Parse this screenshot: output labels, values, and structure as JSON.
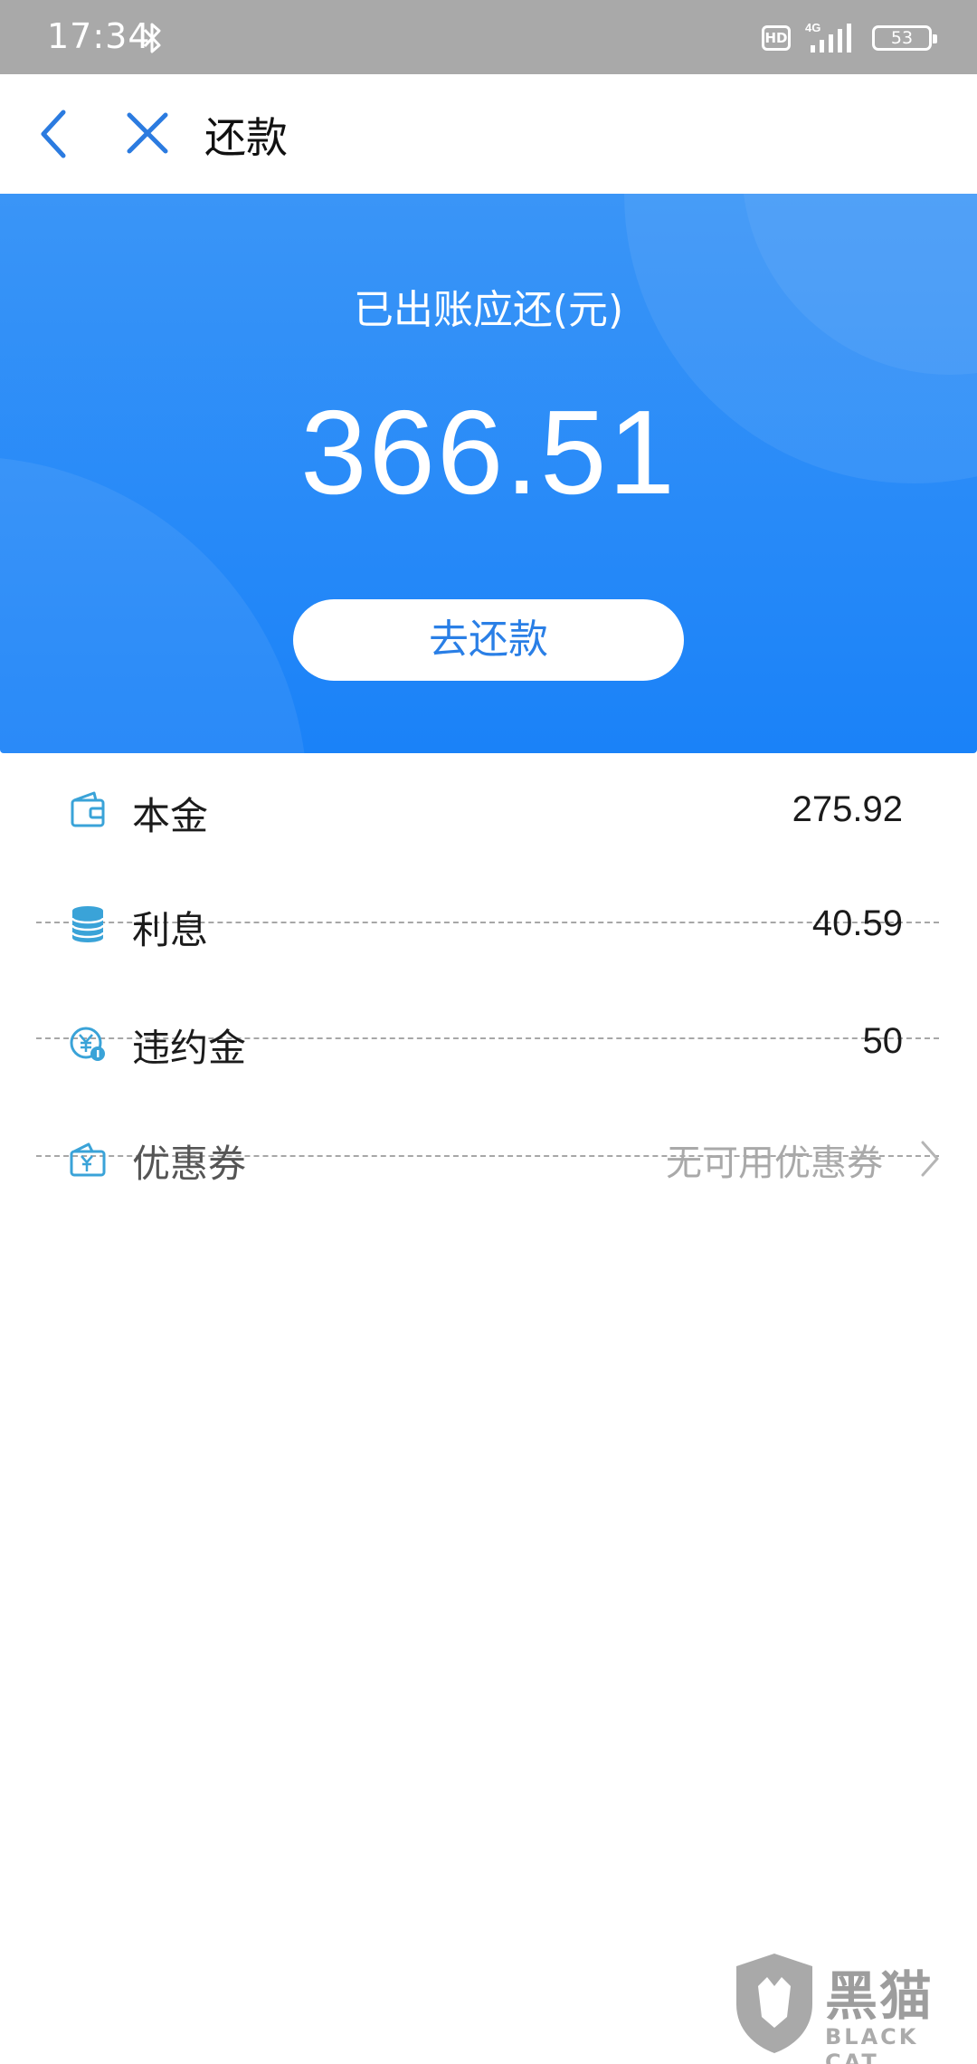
{
  "status_bar": {
    "time": "17:34",
    "bluetooth_icon": "bluetooth-icon",
    "hd_badge": "HD",
    "network": "4G",
    "battery_level": "53"
  },
  "nav": {
    "back_icon": "chevron-left-icon",
    "close_icon": "close-icon",
    "title": "还款"
  },
  "hero": {
    "label": "已出账应还(元)",
    "amount": "366.51",
    "pay_button_label": "去还款"
  },
  "details": [
    {
      "icon": "wallet-icon",
      "label": "本金",
      "value": "275.92"
    },
    {
      "icon": "coins-stack-icon",
      "label": "利息",
      "value": "40.59"
    },
    {
      "icon": "yuan-penalty-icon",
      "label": "违约金",
      "value": "50"
    }
  ],
  "coupon": {
    "icon": "coupon-wallet-icon",
    "label": "优惠券",
    "value": "无可用优惠券",
    "chevron_icon": "chevron-right-icon"
  },
  "watermark": {
    "title": "黑猫",
    "subtitle": "BLACK CAT"
  },
  "colors": {
    "accent": "#1a82f8",
    "status_bar": "#a9a9a9",
    "icon_tint": "#3aa3d8",
    "muted_text": "#a9a9a9"
  }
}
